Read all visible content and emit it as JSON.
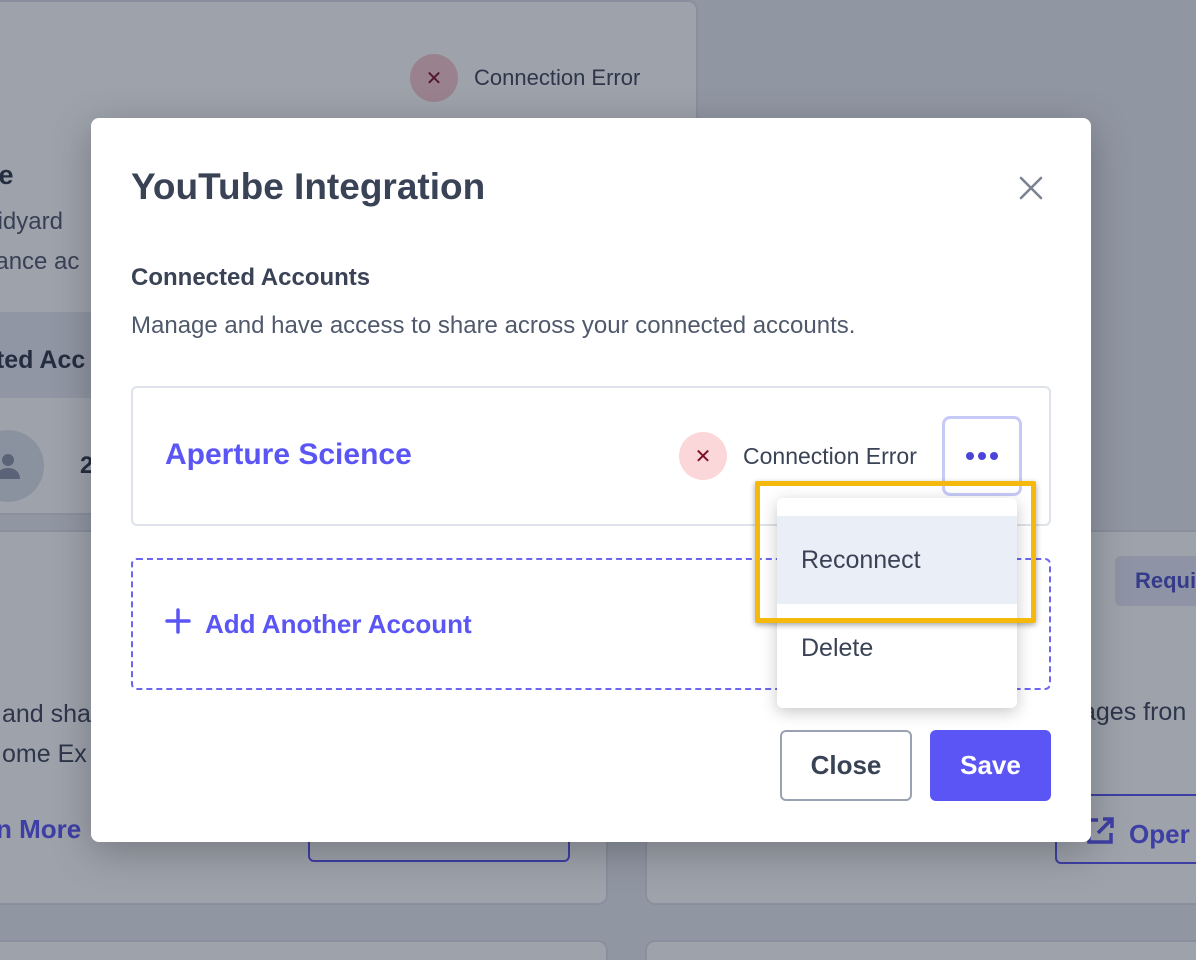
{
  "background": {
    "status_text": "Connection Error",
    "card_title": "be",
    "card_desc_1": "Vidyard",
    "card_desc_2": "nance ac",
    "band_text": "cted Acc",
    "count_text": "2",
    "left_text_1": "and sha",
    "left_text_2": "ome Ex",
    "left_link": "n More",
    "right_badge": "Requir",
    "right_text": "ages fron",
    "right_button": "Oper"
  },
  "modal": {
    "title": "YouTube Integration",
    "section_title": "Connected Accounts",
    "section_desc": "Manage and have access to share across your connected accounts.",
    "account": {
      "name": "Aperture Science",
      "status": "Connection Error"
    },
    "add_account_label": "Add Another Account",
    "close_label": "Close",
    "save_label": "Save"
  },
  "dropdown": {
    "items": [
      {
        "label": "Reconnect"
      },
      {
        "label": "Delete"
      }
    ]
  },
  "colors": {
    "accent": "#5a55f4",
    "error_bg": "#fbd7da",
    "error_icon": "#7a1022",
    "highlight": "#f5b80c"
  },
  "icons": {
    "close": "close-icon",
    "more": "more-horizontal-icon",
    "error": "x-icon",
    "add": "plus-icon"
  }
}
